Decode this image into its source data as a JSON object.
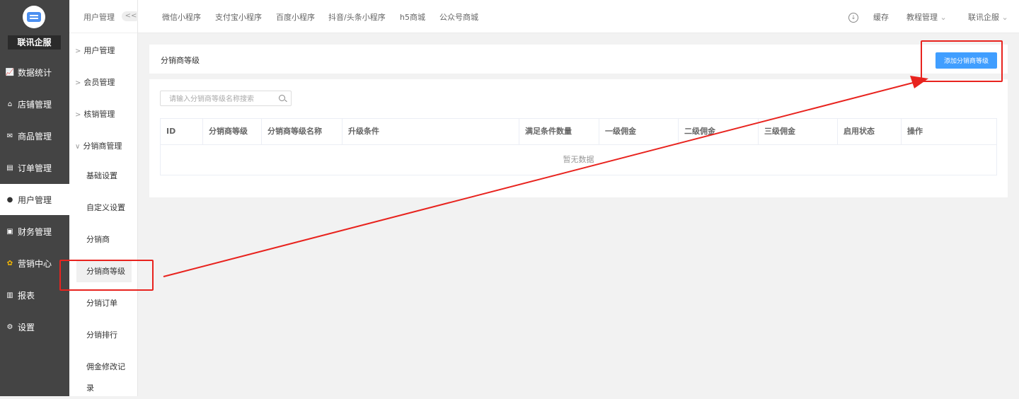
{
  "brand": "联讯企服",
  "nav": [
    {
      "label": "数据统计",
      "icon": "chart-line-icon"
    },
    {
      "label": "店铺管理",
      "icon": "store-icon"
    },
    {
      "label": "商品管理",
      "icon": "goods-icon"
    },
    {
      "label": "订单管理",
      "icon": "order-icon"
    },
    {
      "label": "用户管理",
      "icon": "user-icon",
      "active": true
    },
    {
      "label": "财务管理",
      "icon": "finance-icon"
    },
    {
      "label": "营销中心",
      "icon": "marketing-icon"
    },
    {
      "label": "报表",
      "icon": "report-icon"
    },
    {
      "label": "设置",
      "icon": "gear-icon"
    }
  ],
  "sub": {
    "title": "用户管理",
    "collapse": "<<",
    "groups": [
      "用户管理",
      "会员管理",
      "核销管理",
      "分销商管理"
    ],
    "leaves": [
      "基础设置",
      "自定义设置",
      "分销商",
      "分销商等级",
      "分销订单",
      "分销排行",
      "佣金修改记录"
    ]
  },
  "top": {
    "links": [
      "微信小程序",
      "支付宝小程序",
      "百度小程序",
      "抖音/头条小程序",
      "h5商城",
      "公众号商城"
    ],
    "cache": "缓存",
    "tutorial": "教程管理",
    "account": "联讯企服"
  },
  "page": {
    "title": "分销商等级",
    "add_button": "添加分销商等级",
    "search_placeholder": "请输入分销商等级名称搜索",
    "columns": [
      "ID",
      "分销商等级",
      "分销商等级名称",
      "升级条件",
      "满足条件数量",
      "一级佣金",
      "二级佣金",
      "三级佣金",
      "启用状态",
      "操作"
    ],
    "empty": "暂无数据"
  },
  "colors": {
    "sidebar": "#444444",
    "accent": "#409eff",
    "annotation": "#e8231e"
  }
}
